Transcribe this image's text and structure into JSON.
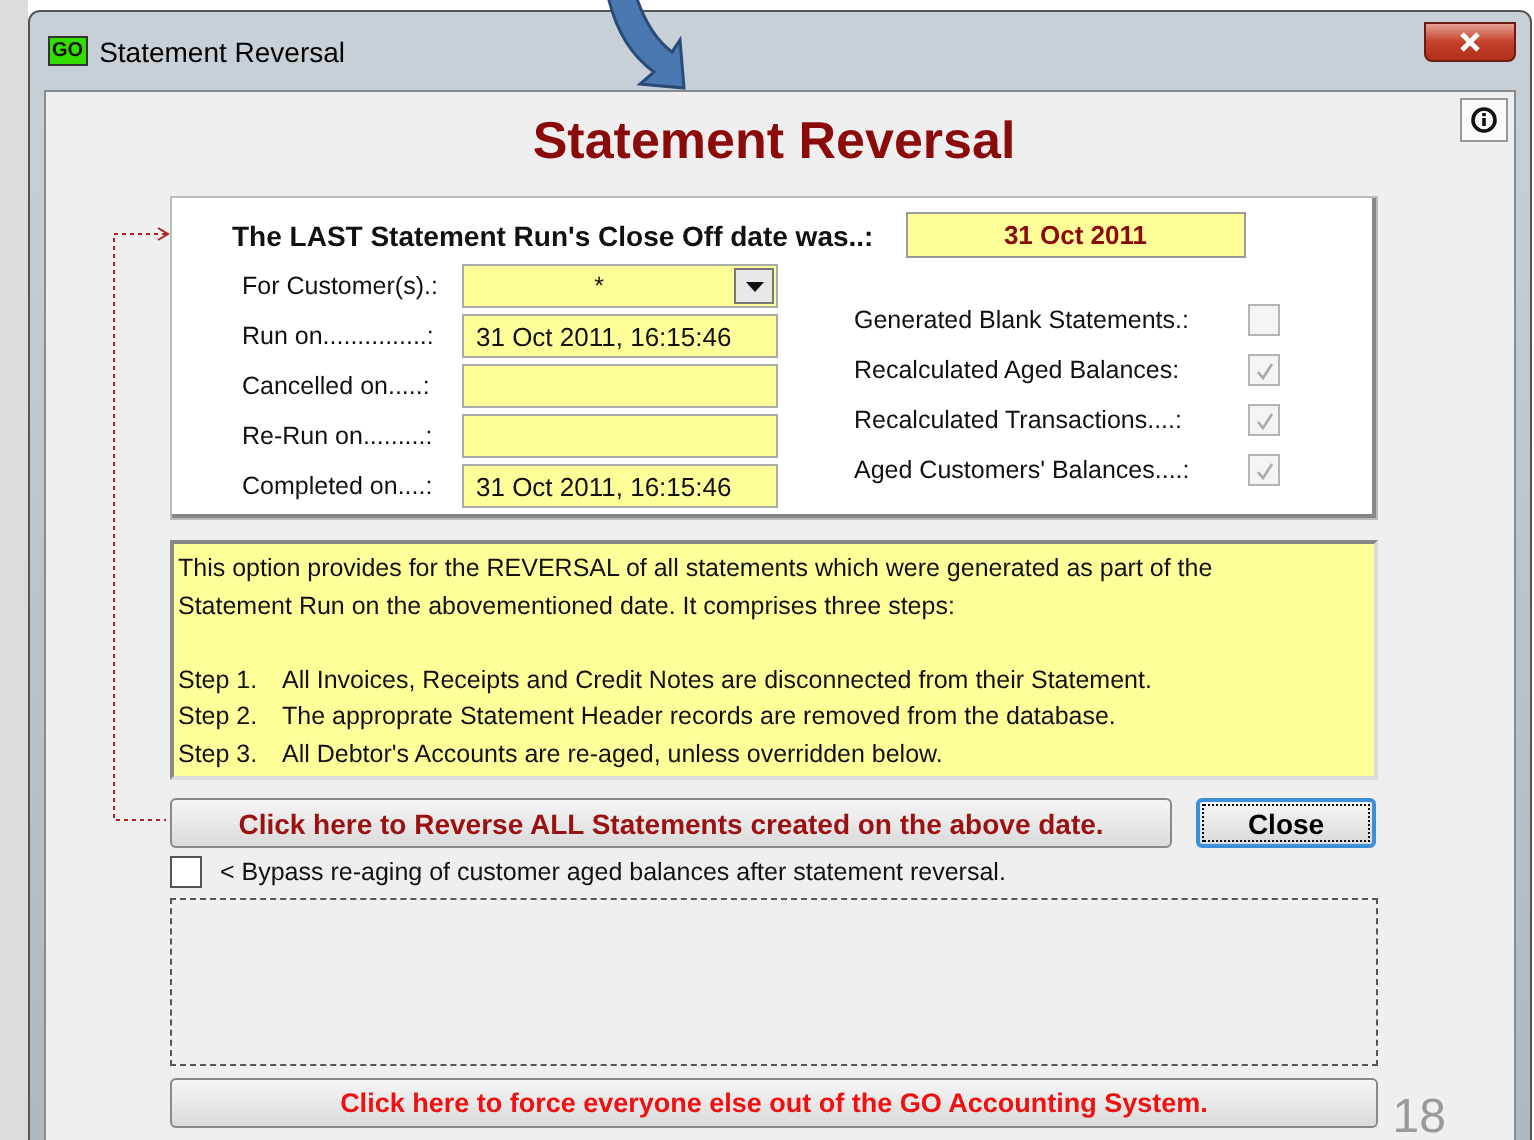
{
  "window": {
    "title": "Statement Reversal",
    "icon_text": "GO"
  },
  "heading": "Statement Reversal",
  "last_run": {
    "label": "The LAST Statement Run's Close Off date was..:",
    "value": "31 Oct 2011"
  },
  "customer": {
    "label": "For Customer(s).:",
    "value": "*"
  },
  "date_fields": [
    {
      "label": "Run on...............:",
      "value": "31 Oct 2011, 16:15:46"
    },
    {
      "label": "Cancelled on.....:"
    },
    {
      "label": "Re-Run on.........:"
    },
    {
      "label": "Completed on....:",
      "value": "31 Oct 2011, 16:15:46"
    }
  ],
  "flags": [
    {
      "label": "Generated Blank Statements.:",
      "checked": false,
      "disabled": true
    },
    {
      "label": "Recalculated Aged Balances:",
      "checked": true,
      "disabled": true
    },
    {
      "label": "Recalculated Transactions....:",
      "checked": true,
      "disabled": true
    },
    {
      "label": "Aged Customers' Balances....:",
      "checked": true,
      "disabled": true
    }
  ],
  "description": {
    "intro": "This option provides for the REVERSAL of all statements which were generated as part of the Statement Run on the abovementioned date.  It comprises three steps:",
    "steps": [
      {
        "step": "Step 1.",
        "text": "All Invoices, Receipts and Credit Notes are disconnected from their Statement."
      },
      {
        "step": "Step 2.",
        "text": "The approprate Statement Header records are removed from the database."
      },
      {
        "step": "Step 3.",
        "text": "All Debtor's Accounts are re-aged, unless overridden below."
      }
    ]
  },
  "reverse_button": "Click here to Reverse ALL Statements created on the above date.",
  "close_button": "Close",
  "bypass": {
    "label": "< Bypass re-aging of customer aged balances after statement reversal.",
    "checked": false
  },
  "force_button": "Click here to force everyone else out of the GO Accounting System.",
  "slide_number": "18"
}
